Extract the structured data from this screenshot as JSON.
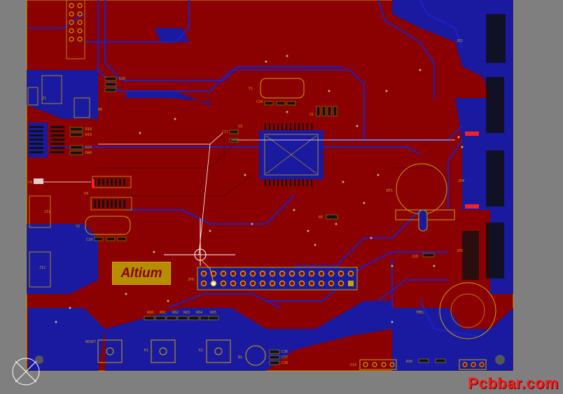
{
  "board": {
    "logo_text": "Altium",
    "watermark": "Pcbbar.com",
    "copper_color": "#8b0000",
    "bottom_copper_color": "#1a1aa0",
    "silk_color": "#c9a400",
    "background_color": "#7f7f7f"
  },
  "labels": {
    "j1": "J1",
    "j11": "J11",
    "j12": "J12",
    "jp8": "JP8",
    "jp2": "JP2",
    "jp4": "JP4",
    "jp5": "JP5",
    "r8": "R8",
    "r18": "R18",
    "r19": "R19",
    "r20": "R20",
    "r24": "R24",
    "r34": "R34",
    "r40": "R40",
    "c4": "C4",
    "c29": "C29",
    "c34": "C34",
    "c36": "C36",
    "c37": "C37",
    "c38": "C38",
    "y1": "Y1",
    "y2": "Y2",
    "u1": "U1",
    "u4": "U4",
    "u14": "U14",
    "k1": "K1",
    "k2": "K2",
    "b1": "B1",
    "bt1": "BT1",
    "reset": "RESET",
    "trace_j": "J10",
    "tmel": "TMEL",
    "r60": "R60",
    "r61": "R61",
    "r62": "R62",
    "r63": "R63",
    "r64": "R64",
    "r65": "R65",
    "rps": "R5",
    "c17": "C17",
    "u3": "U3"
  },
  "tools": {
    "crosshair": "crosshair-cursor",
    "origin": "board-origin-marker"
  }
}
